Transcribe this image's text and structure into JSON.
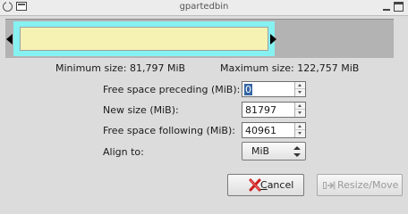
{
  "window": {
    "title": "gpartedbin"
  },
  "partition_bar": {
    "colors": {
      "frame": "#86f1f1",
      "fill": "#f5f2b4",
      "unallocated": "#b3b3b3"
    },
    "icons": {
      "left_handle": "arrow-left-icon",
      "right_handle": "arrow-right-icon"
    }
  },
  "sizes": {
    "minimum": "Minimum size: 81,797 MiB",
    "maximum": "Maximum size: 122,757 MiB"
  },
  "fields": {
    "preceding": {
      "label": "Free space preceding (MiB):",
      "value": "0"
    },
    "new_size": {
      "label": "New size (MiB):",
      "value": "81797"
    },
    "following": {
      "label": "Free space following (MiB):",
      "value": "40961"
    },
    "align": {
      "label": "Align to:",
      "value": "MiB"
    }
  },
  "buttons": {
    "cancel": {
      "label": "Cancel",
      "icon": "cancel-x-icon"
    },
    "resize": {
      "label": "Resize/Move",
      "icon": "resize-move-icon",
      "enabled": false
    }
  }
}
